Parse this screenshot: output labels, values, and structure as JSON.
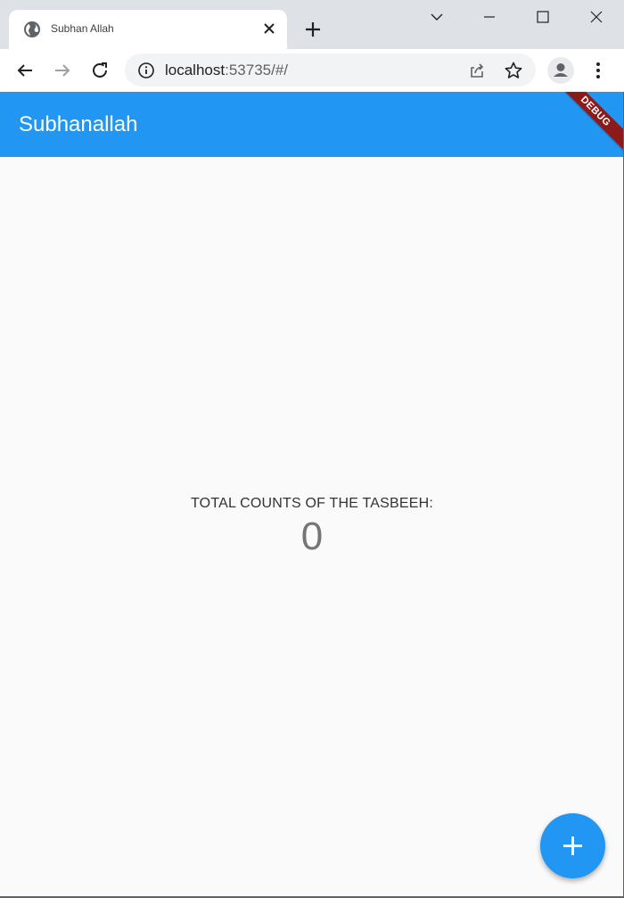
{
  "browser": {
    "tab_title": "Subhan Allah",
    "url_host": "localhost",
    "url_rest": ":53735/#/"
  },
  "app": {
    "title": "Subhanallah",
    "debug_label": "DEBUG",
    "count_label": "TOTAL COUNTS OF THE TASBEEH:",
    "count_value": "0"
  },
  "colors": {
    "primary": "#2196f3",
    "debug_banner": "#8b1a1a",
    "background": "#fafafa"
  },
  "icons": {
    "favicon": "globe-icon",
    "fab": "plus-icon"
  }
}
